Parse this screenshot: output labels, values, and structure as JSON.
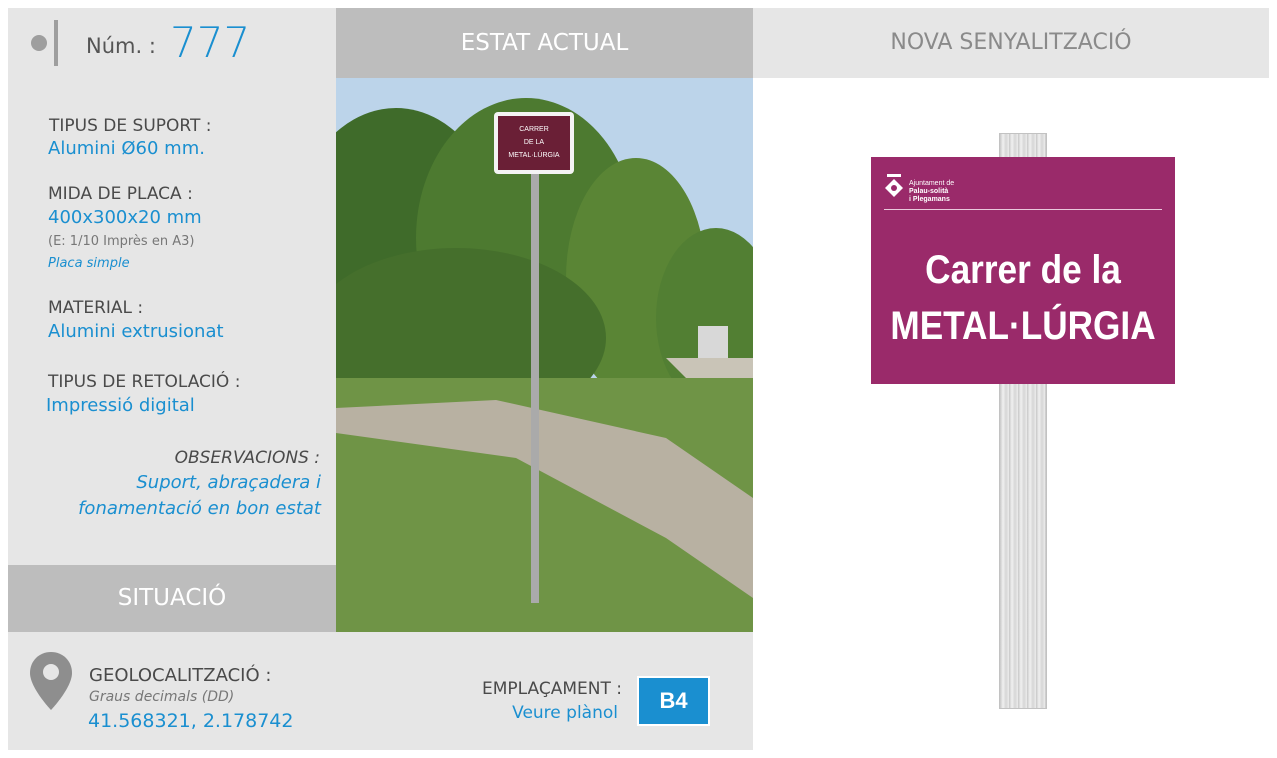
{
  "header": {
    "num_label": "Núm. :",
    "num_value": "777",
    "estat_label": "ESTAT ACTUAL",
    "nova_label": "NOVA SENYALITZACIÓ"
  },
  "specs": {
    "suport_label": "TIPUS DE SUPORT :",
    "suport_value": "Alumini Ø60 mm.",
    "mida_label": "MIDA DE PLACA :",
    "mida_value": "400x300x20 mm",
    "mida_scale": "(E: 1/10 Imprès en A3)",
    "mida_type": "Placa simple",
    "material_label": "MATERIAL :",
    "material_value": "Alumini extrusionat",
    "retolacio_label": "TIPUS DE RETOLACIÓ :",
    "retolacio_value": "Impressió digital",
    "observacions_label": "OBSERVACIONS :",
    "observacions_line1": "Suport, abraçadera i",
    "observacions_line2": "fonamentació en bon estat"
  },
  "situacio": {
    "label": "SITUACIÓ",
    "geo_label": "GEOLOCALITZACIÓ :",
    "geo_format": "Graus decimals (DD)",
    "geo_value": "41.568321, 2.178742",
    "emplacament_label": "EMPLAÇAMENT :",
    "emplacament_link": "Veure plànol",
    "grid_ref": "B4"
  },
  "photo": {
    "sign_line1": "CARRER",
    "sign_line2": "DE LA",
    "sign_line3": "METAL·LÚRGIA"
  },
  "sign": {
    "org_line1": "Ajuntament de",
    "org_line2": "Palau-solità",
    "org_line3": "i Plegamans",
    "line1": "Carrer de la",
    "line2": "METAL·LÚRGIA"
  },
  "colors": {
    "accent_blue": "#1a8fd0",
    "plate_magenta": "#9a2a6a",
    "header_grey": "#bdbdbd",
    "panel_grey": "#e6e6e6"
  }
}
